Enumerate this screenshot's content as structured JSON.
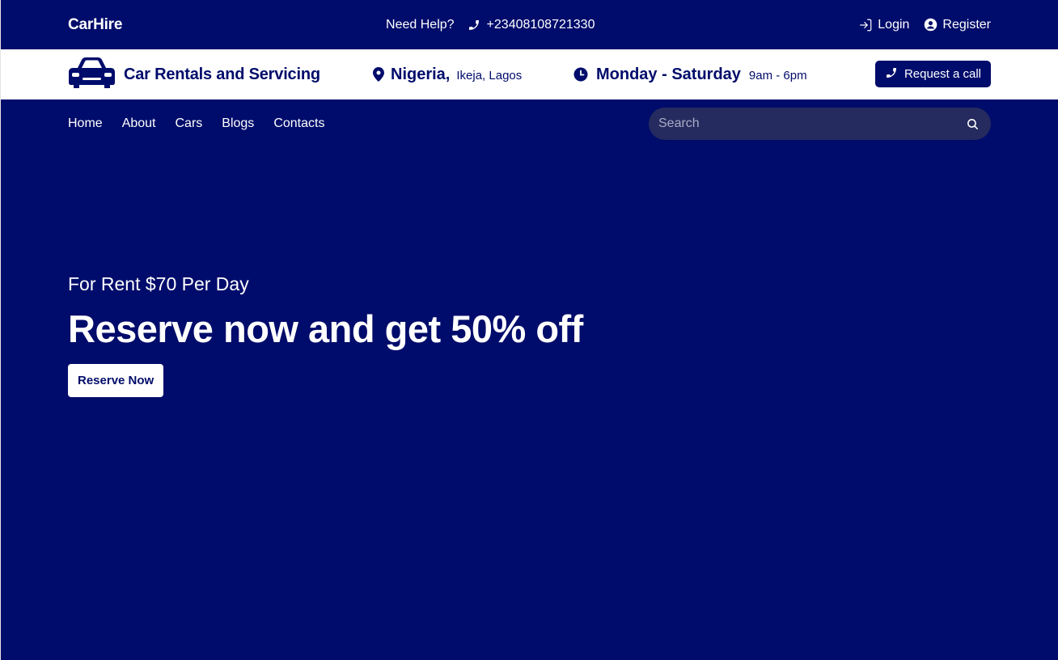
{
  "topbar": {
    "brand": "CarHire",
    "help_label": "Need Help?",
    "phone": "+23408108721330",
    "login": "Login",
    "register": "Register"
  },
  "infobar": {
    "title": "Car Rentals and Servicing",
    "location_country": "Nigeria,",
    "location_city": "Ikeja, Lagos",
    "days": "Monday - Saturday",
    "hours": "9am - 6pm",
    "call_button": "Request a call"
  },
  "nav": {
    "items": [
      "Home",
      "About",
      "Cars",
      "Blogs",
      "Contacts"
    ]
  },
  "search": {
    "placeholder": "Search"
  },
  "hero": {
    "subtitle": "For Rent $70 Per Day",
    "title": "Reserve now and get 50% off",
    "button": "Reserve Now"
  },
  "icons": {
    "phone": "phone-icon",
    "login": "login-icon",
    "register": "user-circle-icon",
    "car": "car-icon",
    "location": "map-pin-icon",
    "clock": "clock-icon",
    "search": "search-icon"
  },
  "colors": {
    "primary": "#000c6b",
    "white": "#ffffff",
    "search_bg": "#252b5e"
  }
}
